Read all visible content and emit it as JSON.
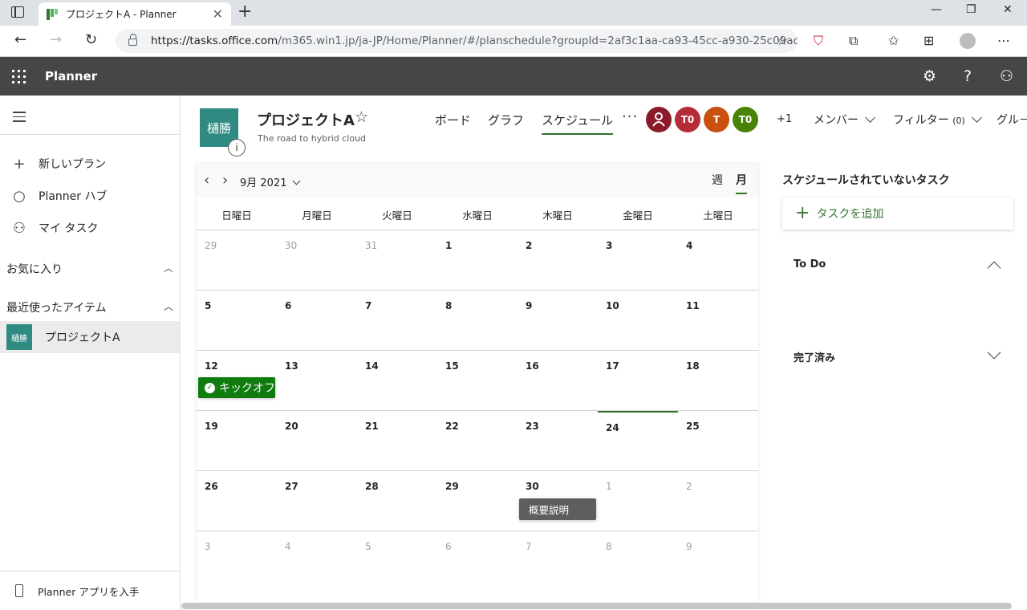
{
  "browser": {
    "tab_title": "プロジェクトA - Planner",
    "url_domain": "https://tasks.office.com",
    "url_path": "/m365.win1.jp/ja-JP/Home/Planner/#/planschedule?groupId=2af3c1aa-ca93-45cc-a930-25c09ace..."
  },
  "app": {
    "name": "Planner"
  },
  "leftnav": {
    "new_plan": "新しいプラン",
    "planner_hub": "Planner ハブ",
    "my_tasks": "マイ タスク",
    "favorites": "お気に入り",
    "recent": "最近使ったアイテム",
    "recent_tile": "樋勝",
    "recent_item": "プロジェクトA",
    "get_app": "Planner アプリを入手"
  },
  "plan": {
    "tile": "樋勝",
    "info": "i",
    "name": "プロジェクトA",
    "description": "The road to hybrid cloud",
    "tabs": [
      "ボード",
      "グラフ",
      "スケジュール"
    ],
    "members": [
      {
        "initials": "",
        "color": "#8b1a2b"
      },
      {
        "initials": "T0",
        "color": "#b52b37"
      },
      {
        "initials": "T",
        "color": "#ca5010"
      },
      {
        "initials": "T0",
        "color": "#498205"
      }
    ],
    "more_members": "+1",
    "members_label": "メンバー",
    "filter_label": "フィルター",
    "filter_count": "(0)",
    "group_label": "グル－"
  },
  "calendar": {
    "month": "9月 2021",
    "view_week": "週",
    "view_month": "月",
    "weekdays": [
      "日曜日",
      "月曜日",
      "火曜日",
      "水曜日",
      "木曜日",
      "金曜日",
      "土曜日"
    ],
    "weeks": [
      [
        "29",
        "30",
        "31",
        "1",
        "2",
        "3",
        "4"
      ],
      [
        "5",
        "6",
        "7",
        "8",
        "9",
        "10",
        "11"
      ],
      [
        "12",
        "13",
        "14",
        "15",
        "16",
        "17",
        "18"
      ],
      [
        "19",
        "20",
        "21",
        "22",
        "23",
        "24",
        "25"
      ],
      [
        "26",
        "27",
        "28",
        "29",
        "30",
        "1",
        "2"
      ],
      [
        "3",
        "4",
        "5",
        "6",
        "7",
        "8",
        "9"
      ]
    ],
    "event": "キックオフ",
    "tooltip": "概要説明"
  },
  "side": {
    "title": "スケジュールされていないタスク",
    "add_task": "タスクを追加",
    "bucket_todo": "To Do",
    "bucket_done": "完了済み"
  },
  "colors": {
    "accent": "#31752f",
    "appbar": "#484644",
    "event": "#107c10"
  }
}
